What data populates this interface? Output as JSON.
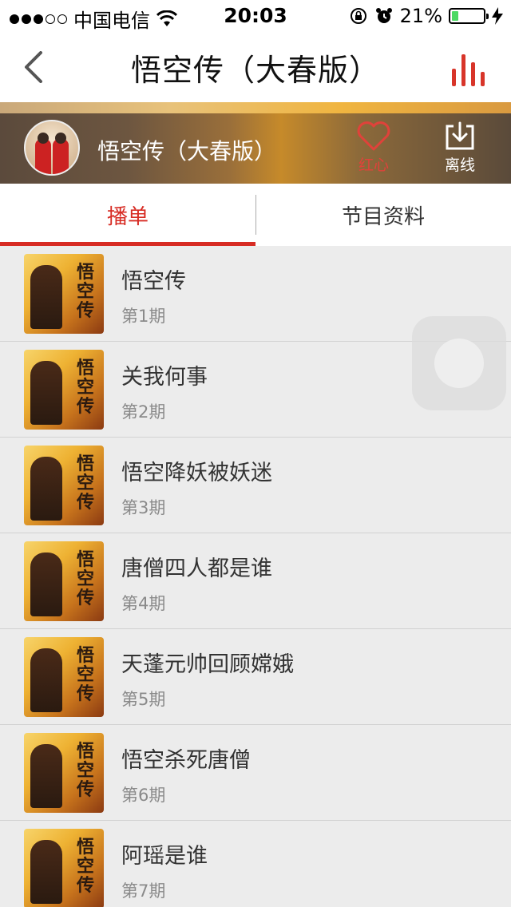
{
  "status_bar": {
    "carrier": "中国电信",
    "time": "20:03",
    "battery": "21%",
    "battery_level": 0.21,
    "signal_bars_filled": 3,
    "signal_bars_total": 5
  },
  "nav": {
    "title": "悟空传（大春版）"
  },
  "header": {
    "title": "悟空传（大春版）",
    "like_label": "红心",
    "offline_label": "离线"
  },
  "tabs": [
    {
      "label": "播单",
      "active": true
    },
    {
      "label": "节目资料",
      "active": false
    }
  ],
  "thumb_text": "悟空传",
  "episodes": [
    {
      "title": "悟空传",
      "subtitle": "第1期"
    },
    {
      "title": "关我何事",
      "subtitle": "第2期"
    },
    {
      "title": "悟空降妖被妖迷",
      "subtitle": "第3期"
    },
    {
      "title": "唐僧四人都是谁",
      "subtitle": "第4期"
    },
    {
      "title": "天蓬元帅回顾嫦娥",
      "subtitle": "第5期"
    },
    {
      "title": "悟空杀死唐僧",
      "subtitle": "第6期"
    },
    {
      "title": "阿瑶是谁",
      "subtitle": "第7期"
    }
  ],
  "colors": {
    "accent": "#d72c24",
    "list_bg": "#ececec"
  }
}
